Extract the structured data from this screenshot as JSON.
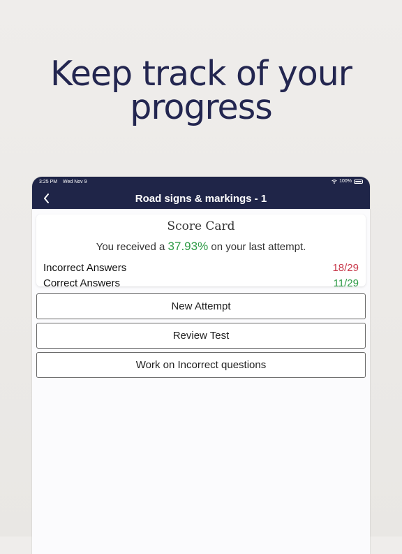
{
  "headline": {
    "line1": "Keep track of your",
    "line2": "progress"
  },
  "status_bar": {
    "time": "3:25 PM",
    "date": "Wed Nov 9",
    "battery": "100%"
  },
  "nav": {
    "title": "Road signs & markings - 1",
    "back_icon": "chevron-left-icon"
  },
  "score_card": {
    "title": "Score Card",
    "received_prefix": "You received a",
    "percentage": "37.93%",
    "received_suffix": "on your last attempt.",
    "incorrect_label": "Incorrect Answers",
    "incorrect_value": "18/29",
    "correct_label": "Correct Answers",
    "correct_value": "11/29"
  },
  "buttons": {
    "new_attempt": "New Attempt",
    "review_test": "Review Test",
    "work_incorrect": "Work on Incorrect questions"
  },
  "colors": {
    "nav_background": "#1f2548",
    "headline": "#232650",
    "correct": "#2e9b46",
    "incorrect": "#c8384a"
  }
}
